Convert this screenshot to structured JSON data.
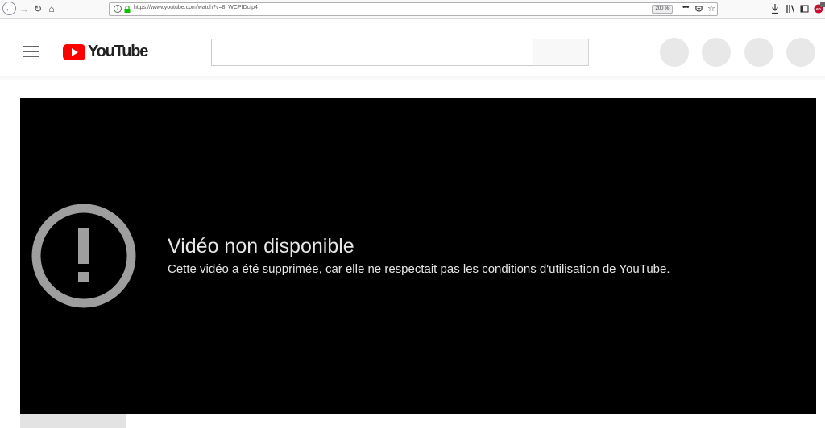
{
  "browser": {
    "url": "https://www.youtube.com/watch?v=8_WCPIDcIp4",
    "zoom": "200 %",
    "info_glyph": "i",
    "more_glyph": "•••",
    "icons": [
      "back-icon",
      "forward-icon",
      "reload-icon",
      "home-icon",
      "info-icon",
      "lock-icon",
      "page-actions-icon",
      "pocket-icon",
      "bookmark-star-icon",
      "download-icon",
      "library-icon",
      "sidebar-icon",
      "addon-icon"
    ]
  },
  "masthead": {
    "logo_text": "YouTube",
    "search_value": "",
    "icons": [
      "menu-icon",
      "youtube-logo",
      "search-button",
      "avatar-placeholder"
    ]
  },
  "player": {
    "error_title": "Vidéo non disponible",
    "error_message": "Cette vidéo a été supprimée, car elle ne respectait pas les conditions d'utilisation de YouTube.",
    "icon": "alert-icon"
  },
  "colors": {
    "youtube_red": "#ff0000",
    "player_bg": "#000000",
    "error_text": "#e6e6e6",
    "placeholder_gray": "#e8e8e8",
    "alert_gray": "#9e9e9e"
  }
}
